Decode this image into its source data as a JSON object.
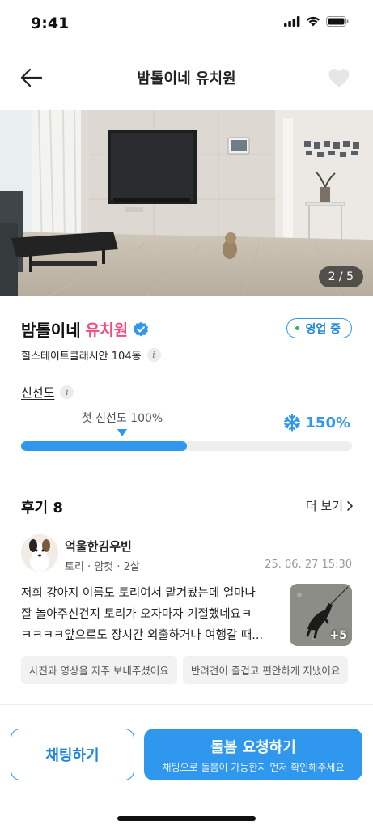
{
  "status_bar": {
    "time": "9:41"
  },
  "nav": {
    "title": "밤톨이네 유치원"
  },
  "photo": {
    "counter": "2 / 5"
  },
  "profile": {
    "name": "밤톨이네",
    "type": "유치원",
    "status": "영업 중",
    "address": "힐스테이트클래시안 104동"
  },
  "freshness": {
    "label": "신선도",
    "caption": "첫 신선도 100%",
    "value_text": "150%",
    "progress_fraction": 0.5
  },
  "reviews": {
    "title": "후기 8",
    "more": "더 보기",
    "items": [
      {
        "name": "억울한김우빈",
        "pet": "토리 · 암컷 · 2살",
        "date": "25. 06. 27 15:30",
        "lines": [
          "저희 강아지 이름도 토리여서 맡겨봤는데 얼마나",
          "잘 놀아주신건지 토리가 오자마자 기절했네요ㅋ",
          "ㅋㅋㅋㅋ앞으로도 장시간 외출하거나 여행갈 때..."
        ],
        "photo_count": "+5",
        "tags": [
          "사진과 영상을 자주 보내주셨어요",
          "반려견이 즐겁고 편안하게 지냈어요"
        ]
      }
    ]
  },
  "actions": {
    "chat": "채팅하기",
    "request": "돌봄 요청하기",
    "request_sub": "채팅으로 돌봄이 가능한지 먼저 확인해주세요"
  },
  "colors": {
    "primary": "#2f97ee",
    "pink": "#ef4d7e",
    "open_dot": "#2db46a"
  }
}
